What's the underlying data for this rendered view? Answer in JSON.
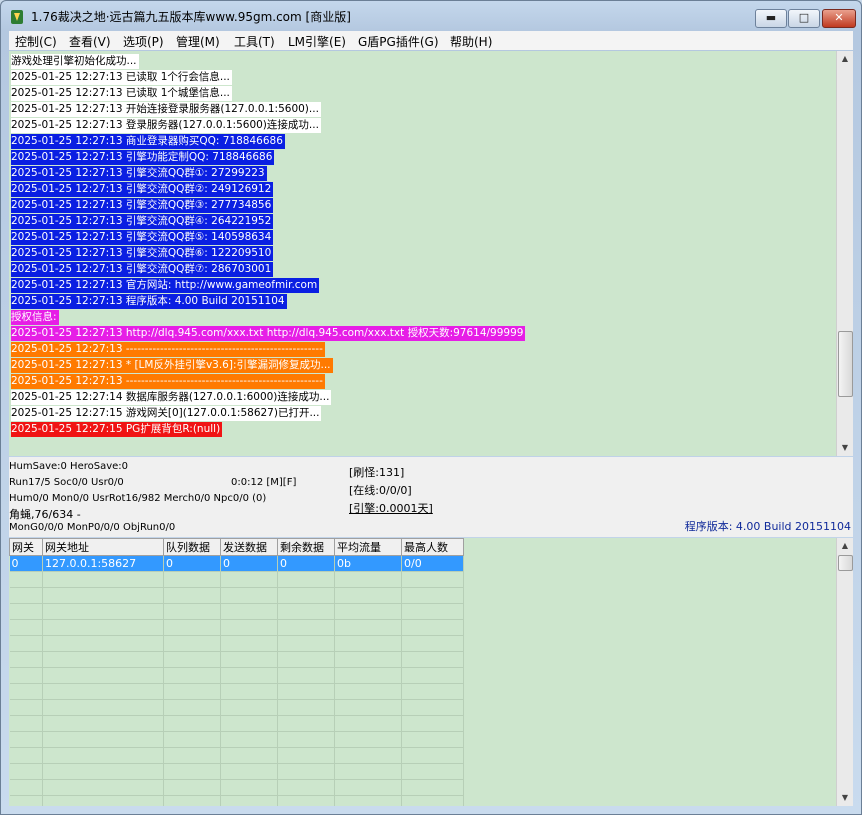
{
  "window": {
    "title": "1.76裁决之地·远古篇九五版本库www.95gm.com [商业版]"
  },
  "menu": [
    "控制(C)",
    "查看(V)",
    "选项(P)",
    "管理(M)",
    "工具(T)",
    "LM引擎(E)",
    "G盾PG插件(G)",
    "帮助(H)"
  ],
  "log": [
    {
      "text": "游戏处理引擎初始化成功...",
      "style": "white"
    },
    {
      "text": "2025-01-25 12:27:13 已读取 1个行会信息...",
      "style": "white"
    },
    {
      "text": "2025-01-25 12:27:13 已读取 1个城堡信息...",
      "style": "white"
    },
    {
      "text": "2025-01-25 12:27:13 开始连接登录服务器(127.0.0.1:5600)...",
      "style": "white"
    },
    {
      "text": "2025-01-25 12:27:13 登录服务器(127.0.0.1:5600)连接成功...",
      "style": "white"
    },
    {
      "text": "2025-01-25 12:27:13 商业登录器购买QQ: 718846686",
      "style": "blue"
    },
    {
      "text": "2025-01-25 12:27:13 引擎功能定制QQ: 718846686",
      "style": "blue"
    },
    {
      "text": "2025-01-25 12:27:13 引擎交流QQ群①: 27299223",
      "style": "blue"
    },
    {
      "text": "2025-01-25 12:27:13 引擎交流QQ群②: 249126912",
      "style": "blue"
    },
    {
      "text": "2025-01-25 12:27:13 引擎交流QQ群③: 277734856",
      "style": "blue"
    },
    {
      "text": "2025-01-25 12:27:13 引擎交流QQ群④: 264221952",
      "style": "blue"
    },
    {
      "text": "2025-01-25 12:27:13 引擎交流QQ群⑤: 140598634",
      "style": "blue"
    },
    {
      "text": "2025-01-25 12:27:13 引擎交流QQ群⑥: 122209510",
      "style": "blue"
    },
    {
      "text": "2025-01-25 12:27:13 引擎交流QQ群⑦: 286703001",
      "style": "blue"
    },
    {
      "text": "2025-01-25 12:27:13 官方网站: http://www.gameofmir.com",
      "style": "blue"
    },
    {
      "text": "2025-01-25 12:27:13 程序版本: 4.00 Build 20151104",
      "style": "blue"
    },
    {
      "text": "授权信息:",
      "style": "magenta"
    },
    {
      "text": "2025-01-25 12:27:13 http://dlq.945.com/xxx.txt http://dlq.945.com/xxx.txt 授权天数:97614/99999",
      "style": "magenta"
    },
    {
      "text": "2025-01-25 12:27:13 ----------------------------------------------------",
      "style": "orange"
    },
    {
      "text": "2025-01-25 12:27:13 * [LM反外挂引擎v3.6]:引擎漏洞修复成功...",
      "style": "orange"
    },
    {
      "text": "2025-01-25 12:27:13 ----------------------------------------------------",
      "style": "orange"
    },
    {
      "text": "2025-01-25 12:27:14 数据库服务器(127.0.0.1:6000)连接成功...",
      "style": "white"
    },
    {
      "text": "2025-01-25 12:27:15 游戏网关[0](127.0.0.1:58627)已打开...",
      "style": "white"
    },
    {
      "text": "2025-01-25 12:27:15 PG扩展背包R:(null)",
      "style": "red"
    }
  ],
  "status": {
    "line1": "HumSave:0 HeroSave:0",
    "line2": "Run17/5 Soc0/0 Usr0/0",
    "time": "0:0:12 [M][F]",
    "line3": "Hum0/0 Mon0/0 UsrRot16/982 Merch0/0 Npc0/0 (0)",
    "line4": "角蝇,76/634 -",
    "line5": "MonG0/0/0 MonP0/0/0 ObjRun0/0",
    "refresh": "[刷怪:131]",
    "online": "[在线:0/0/0]",
    "engine": "[引擎:0.0001天]",
    "version": "程序版本: 4.00 Build 20151104"
  },
  "gate_table": {
    "headers": [
      "网关",
      "网关地址",
      "队列数据",
      "发送数据",
      "剩余数据",
      "平均流量",
      "最高人数"
    ],
    "rows": [
      [
        "0",
        "127.0.0.1:58627",
        "0",
        "0",
        "0",
        "0b",
        "0/0"
      ]
    ]
  }
}
